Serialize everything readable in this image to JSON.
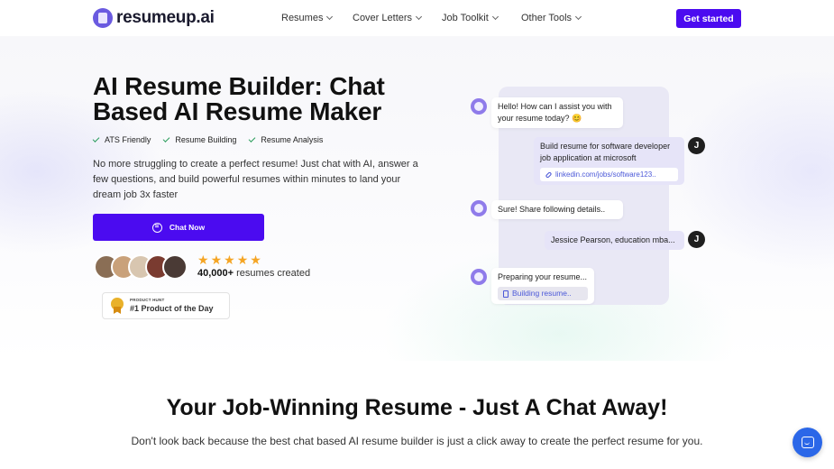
{
  "nav": {
    "logo_text": "resumeup.ai",
    "items": [
      {
        "label": "Resumes"
      },
      {
        "label": "Cover Letters"
      },
      {
        "label": "Job Toolkit"
      },
      {
        "label": "Other Tools"
      }
    ],
    "cta_label": "Get started"
  },
  "hero": {
    "title": "AI Resume Builder: Chat Based AI Resume Maker",
    "features": [
      "ATS Friendly",
      "Resume Building",
      "Resume Analysis"
    ],
    "description": "No more struggling to create a perfect resume! Just chat with AI, answer a few questions, and build powerful resumes within minutes to land your dream job 3x faster",
    "chat_button_label": "Chat Now",
    "rating_stars": 5,
    "resumes_count": "40,000+",
    "resumes_suffix": "resumes created",
    "badge_small": "PRODUCT HUNT",
    "badge_big": "#1 Product of the Day"
  },
  "chat": {
    "bot_msg_1": "Hello! How can I assist you with your resume today? 😊",
    "user_avatar_letter": "J",
    "user_msg_1": "Build resume for software developer job application at microsoft",
    "user_link": "linkedin.com/jobs/software123..",
    "bot_msg_2": "Sure! Share following details..",
    "user_msg_2": "Jessice Pearson, education mba...",
    "bot_msg_3": "Preparing your resume...",
    "bot_status": "Building resume.."
  },
  "section2": {
    "heading": "Your Job-Winning Resume - Just A Chat Away!",
    "subheading": "Don't look back because the best chat based AI resume builder is just a click away to create the perfect resume for you."
  },
  "colors": {
    "primary": "#4b0bf0",
    "star": "#f5a524",
    "check": "#2a9d5c",
    "help": "#2b67e8"
  }
}
